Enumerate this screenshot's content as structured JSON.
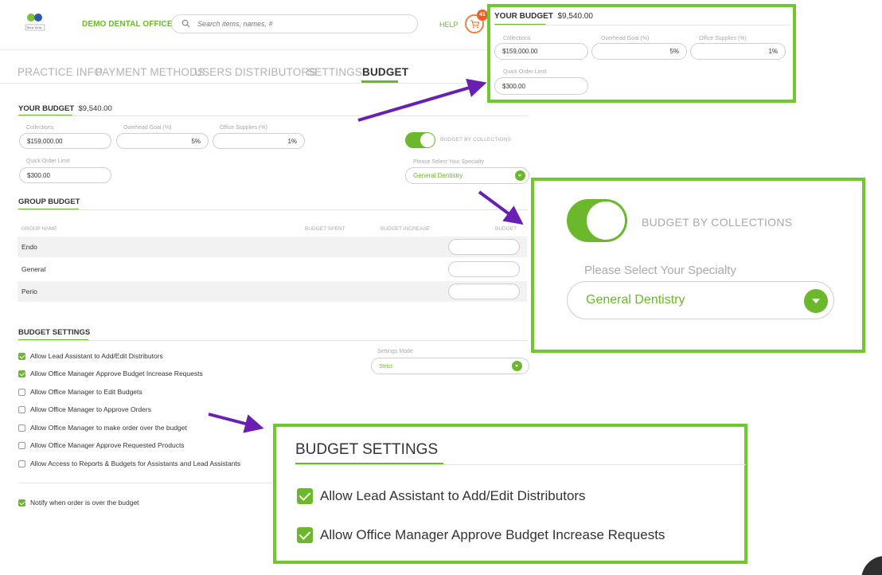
{
  "header": {
    "brand": "DEMO DENTAL OFFICE",
    "search_placeholder": "Search items, names, #",
    "help": "HELP",
    "cart_count": "41",
    "logo_text": "Terra Terra"
  },
  "tabs": [
    {
      "label": "PRACTICE INFO"
    },
    {
      "label": "PAYMENT METHODS"
    },
    {
      "label": "USERS"
    },
    {
      "label": "DISTRIBUTORS"
    },
    {
      "label": "SETTINGS"
    },
    {
      "label": "BUDGET",
      "active": true
    }
  ],
  "your_budget": {
    "title": "YOUR BUDGET",
    "amount": "$9,540.00",
    "collections_label": "Collections",
    "collections_value": "$159,000.00",
    "overhead_label": "Overhead Goal (%)",
    "overhead_value": "5%",
    "supplies_label": "Office Supplies (%)",
    "supplies_value": "1%",
    "quick_label": "Quick Order Limit",
    "quick_value": "$300.00",
    "toggle_label": "BUDGET BY COLLECTIONS",
    "specialty_label": "Please Select Your Specialty",
    "specialty_value": "General Dentistry"
  },
  "group_budget": {
    "title": "GROUP BUDGET",
    "columns": {
      "name": "GROUP NAME",
      "spent": "BUDGET SPENT",
      "increase": "BUDGET INCREASE",
      "budget": "BUDGET"
    },
    "rows": [
      {
        "name": "Endo"
      },
      {
        "name": "General"
      },
      {
        "name": "Perio"
      }
    ]
  },
  "budget_settings": {
    "title": "BUDGET SETTINGS",
    "mode_label": "Settings Mode",
    "mode_value": "Strict",
    "options": [
      {
        "label": "Allow Lead Assistant to Add/Edit Distributors",
        "checked": true
      },
      {
        "label": "Allow Office Manager Approve Budget Increase Requests",
        "checked": true
      },
      {
        "label": "Allow Office Manager to Edit Budgets",
        "checked": false
      },
      {
        "label": "Allow Office Manager to Approve Orders",
        "checked": false
      },
      {
        "label": "Allow Office Manager to make order over the budget",
        "checked": false
      },
      {
        "label": "Allow Office Manager Approve Requested Products",
        "checked": false
      },
      {
        "label": "Allow Access to Reports & Budgets for Assistants and Lead Assistants",
        "checked": false
      }
    ],
    "notify": {
      "label": "Notify when order is over the budget",
      "checked": true
    }
  },
  "colors": {
    "accent": "#6cb82c",
    "callout_border": "#6ec92c",
    "arrow": "#6a1fb3",
    "badge": "#f25c2a"
  }
}
